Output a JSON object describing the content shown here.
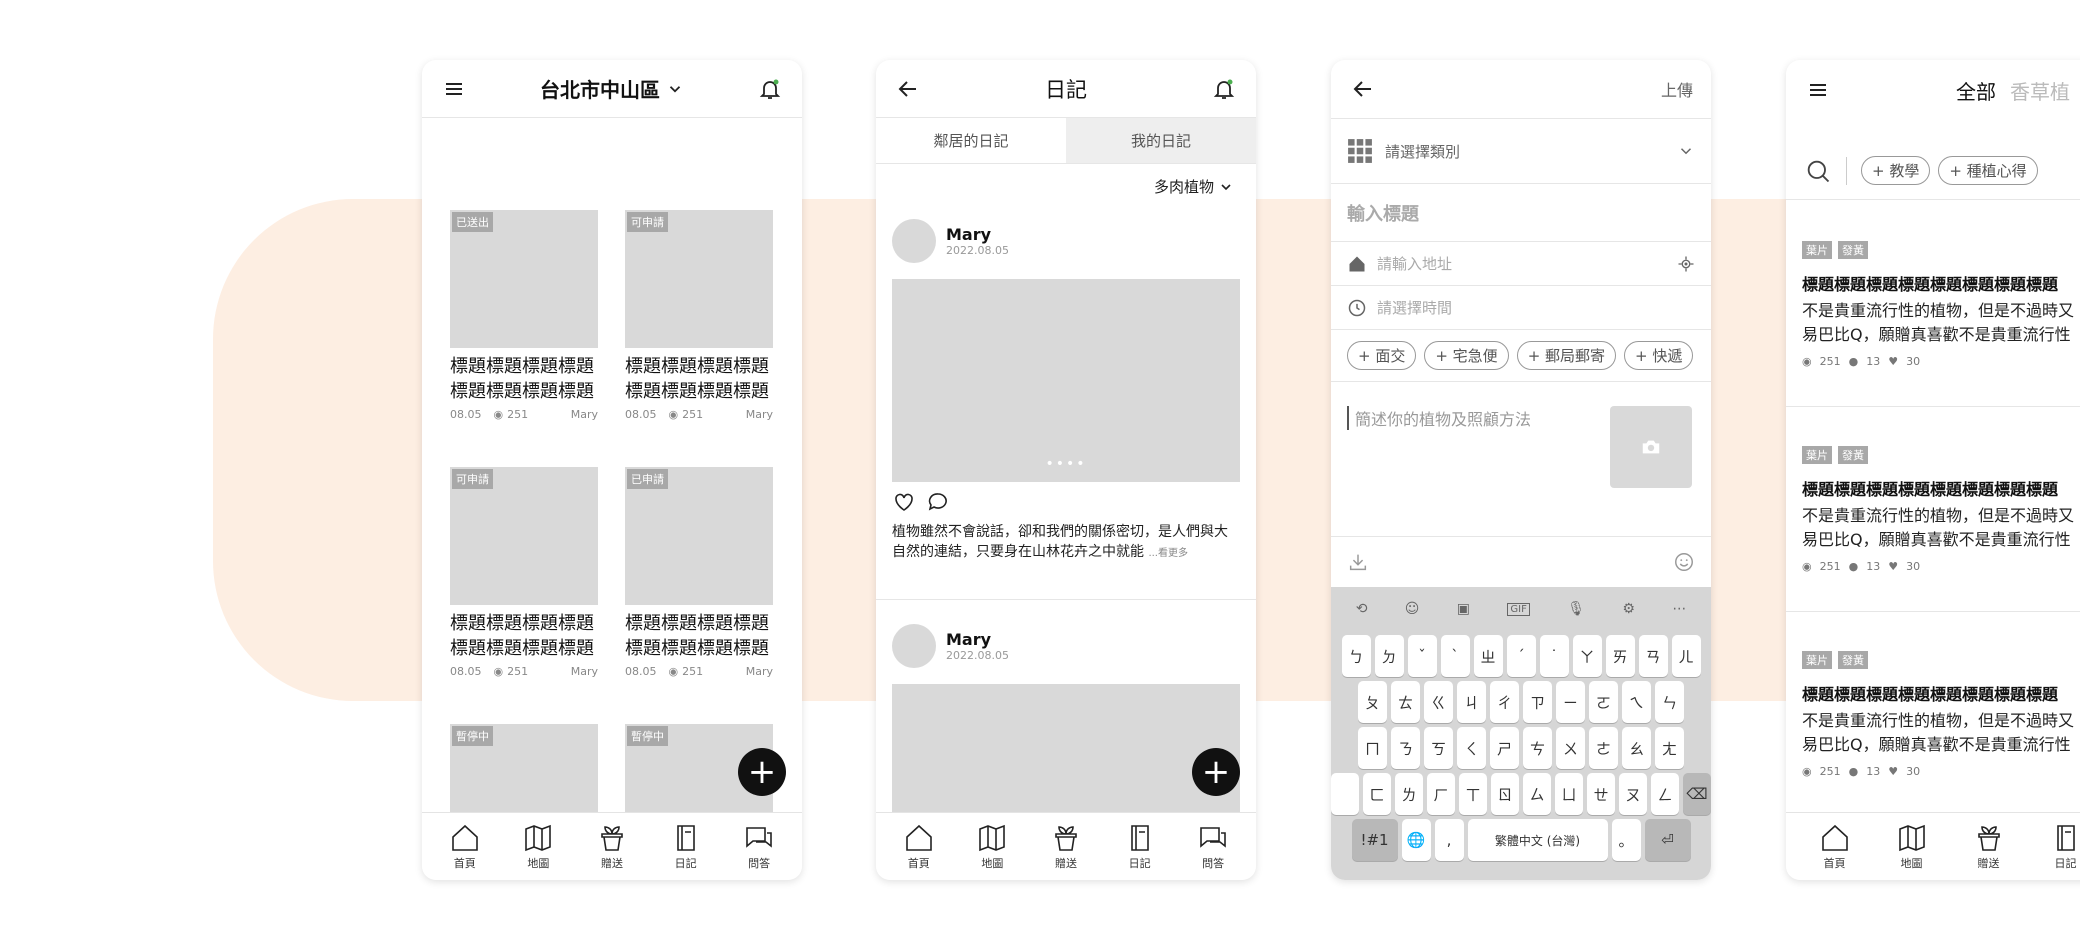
{
  "screen1": {
    "location": "台北市中山區",
    "cards": [
      {
        "badge": "已送出",
        "title": "標題標題標題標題標題標題標題標題",
        "date": "08.05",
        "views": "251",
        "author": "Mary"
      },
      {
        "badge": "可申請",
        "title": "標題標題標題標題標題標題標題標題",
        "date": "08.05",
        "views": "251",
        "author": "Mary"
      },
      {
        "badge": "可申請",
        "title": "標題標題標題標題標題標題標題標題",
        "date": "08.05",
        "views": "251",
        "author": "Mary"
      },
      {
        "badge": "已申請",
        "title": "標題標題標題標題標題標題標題標題",
        "date": "08.05",
        "views": "251",
        "author": "Mary"
      },
      {
        "badge": "暫停中",
        "title": "",
        "date": "",
        "views": "",
        "author": ""
      },
      {
        "badge": "暫停中",
        "title": "",
        "date": "",
        "views": "",
        "author": ""
      }
    ],
    "fab": "+"
  },
  "nav": [
    "首頁",
    "地圖",
    "贈送",
    "日記",
    "問答"
  ],
  "screen2": {
    "title": "日記",
    "tabs": [
      "鄰居的日記",
      "我的日記"
    ],
    "filter": "多肉植物",
    "posts": [
      {
        "user": "Mary",
        "date": "2022.08.05",
        "dots": "••••",
        "text": "植物雖然不會說話，卻和我們的關係密切，是人們與大自然的連結，只要身在山林花卉之中就能",
        "more": "...看更多"
      },
      {
        "user": "Mary",
        "date": "2022.08.05"
      }
    ]
  },
  "screen3": {
    "upload": "上傳",
    "category_placeholder": "請選擇類別",
    "title_placeholder": "輸入標題",
    "address_placeholder": "請輸入地址",
    "time_placeholder": "請選擇時間",
    "chips": [
      "+ 面交",
      "+ 宅急便",
      "+ 郵局郵寄",
      "+ 快遞"
    ],
    "desc_placeholder": "簡述你的植物及照顧方法",
    "keyboard": {
      "tool_gif": "GIF",
      "row1": [
        "ㄅ",
        "ㄉ",
        "ˇ",
        "ˋ",
        "ㄓ",
        "ˊ",
        "˙",
        "ㄚ",
        "ㄞ",
        "ㄢ",
        "ㄦ"
      ],
      "row2": [
        "ㄆ",
        "ㄊ",
        "ㄍ",
        "ㄐ",
        "ㄔ",
        "ㄗ",
        "ㄧ",
        "ㄛ",
        "ㄟ",
        "ㄣ"
      ],
      "row3": [
        "ㄇ",
        "ㄋ",
        "ㄎ",
        "ㄑ",
        "ㄕ",
        "ㄘ",
        "ㄨ",
        "ㄜ",
        "ㄠ",
        "ㄤ"
      ],
      "row4": [
        "ㄈ",
        "ㄌ",
        "ㄏ",
        "ㄒ",
        "ㄖ",
        "ㄙ",
        "ㄩ",
        "ㄝ",
        "ㄡ",
        "ㄥ"
      ],
      "symbols": "!#1",
      "comma": ",",
      "space": "繁體中文 (台灣)",
      "period": "。"
    }
  },
  "screen4": {
    "tab_all": "全部",
    "tab_next": "香草植",
    "filters": [
      "+ 教學",
      "+ 種植心得"
    ],
    "articles": [
      {
        "tags": [
          "葉片",
          "發黃"
        ],
        "title": "標題標題標題標題標題標題標題標題",
        "line1": "不是貴重流行性的植物，但是不過時又",
        "line2": "易巴比Q，願贈真喜歡不是貴重流行性",
        "views": "251",
        "comments": "13",
        "likes": "30"
      },
      {
        "tags": [
          "葉片",
          "發黃"
        ],
        "title": "標題標題標題標題標題標題標題標題",
        "line1": "不是貴重流行性的植物，但是不過時又",
        "line2": "易巴比Q，願贈真喜歡不是貴重流行性",
        "views": "251",
        "comments": "13",
        "likes": "30"
      },
      {
        "tags": [
          "葉片",
          "發黃"
        ],
        "title": "標題標題標題標題標題標題標題標題",
        "line1": "不是貴重流行性的植物，但是不過時又",
        "line2": "易巴比Q，願贈真喜歡不是貴重流行性",
        "views": "251",
        "comments": "13",
        "likes": "30"
      }
    ]
  }
}
